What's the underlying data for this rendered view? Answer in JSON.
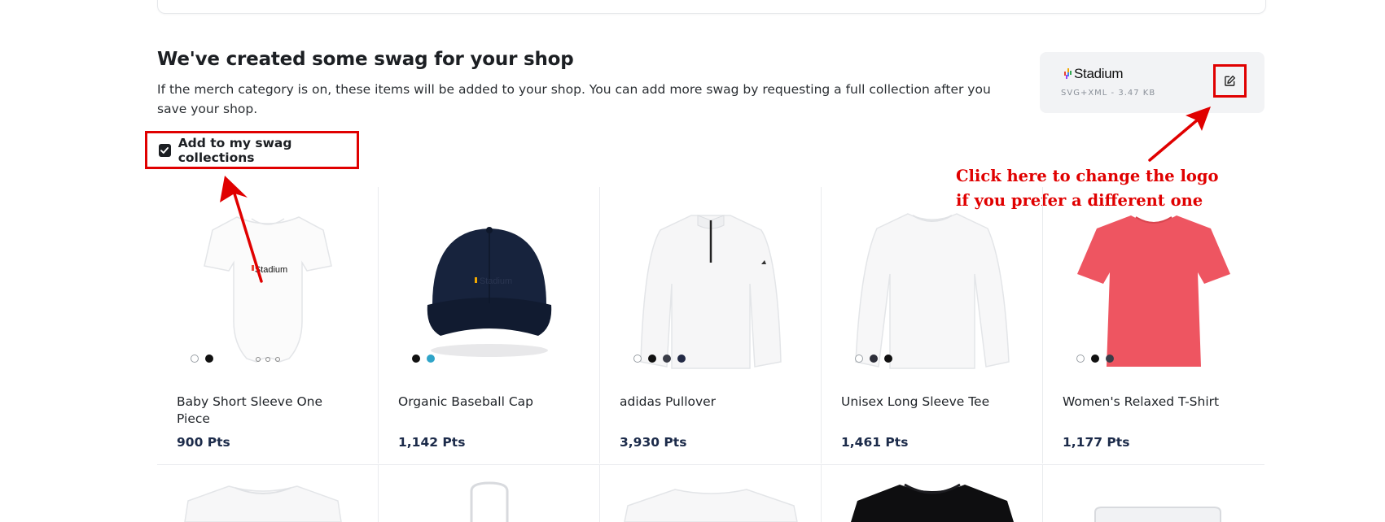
{
  "section": {
    "title": "We've created some swag for your shop",
    "description": "If the merch category is on, these items will be added to your shop. You can add more swag by requesting a full collection after you save your shop."
  },
  "swag_checkbox": {
    "label": "Add to my swag collections",
    "checked": true
  },
  "logo_card": {
    "logo_name": "Stadium",
    "file_meta": "SVG+XML - 3.47 KB",
    "edit_icon": "edit-icon"
  },
  "annotation": {
    "line1": "Click here to change the logo",
    "line2": "if you prefer a different one",
    "color": "#e00000"
  },
  "products": [
    {
      "name": "Baby Short Sleeve One Piece",
      "price": "900 Pts",
      "swatches": [
        "#ffffff",
        "#111111"
      ]
    },
    {
      "name": "Organic Baseball Cap",
      "price": "1,142 Pts",
      "swatches": [
        "#111111",
        "#2fa4c8"
      ]
    },
    {
      "name": "adidas Pullover",
      "price": "3,930 Pts",
      "swatches": [
        "#ffffff",
        "#111111",
        "#3a3d48",
        "#232a45"
      ]
    },
    {
      "name": "Unisex Long Sleeve Tee",
      "price": "1,461 Pts",
      "swatches": [
        "#ffffff",
        "#2e2f3a",
        "#111111"
      ]
    },
    {
      "name": "Women's Relaxed T-Shirt",
      "price": "1,177 Pts",
      "swatches": [
        "#ffffff",
        "#111111",
        "#3a3d48"
      ]
    }
  ]
}
